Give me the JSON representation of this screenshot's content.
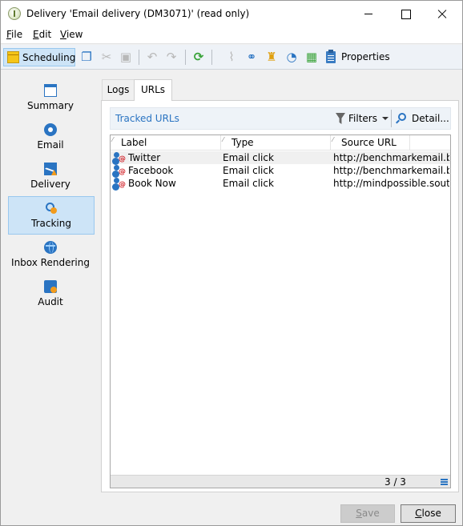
{
  "window": {
    "title": "Delivery 'Email delivery (DM3071)' (read only)",
    "icon": "delivery-app-icon",
    "controls": [
      "minimize-icon",
      "maximize-icon",
      "close-icon"
    ]
  },
  "menu": {
    "file": {
      "mnemonic": "F",
      "rest": "ile"
    },
    "edit": {
      "mnemonic": "E",
      "rest": "dit"
    },
    "view": {
      "mnemonic": "V",
      "rest": "iew"
    }
  },
  "toolbar": {
    "scheduling_label": "Scheduling",
    "properties_label": "Properties",
    "icons": [
      "calendar-icon",
      "copy-icon",
      "cut-icon",
      "paste-icon",
      "undo-icon",
      "redo-icon",
      "refresh-icon",
      "attachment-icon",
      "link-icon",
      "gift-icon",
      "analyze-icon",
      "calculator-icon",
      "clipboard-icon"
    ],
    "accent_color": "#2a74c2",
    "green": "#3aa33a"
  },
  "nav": {
    "items": [
      {
        "label": "Summary",
        "icon": "summary-icon"
      },
      {
        "label": "Email",
        "icon": "email-icon"
      },
      {
        "label": "Delivery",
        "icon": "delivery-icon"
      },
      {
        "label": "Tracking",
        "icon": "tracking-icon",
        "selected": true
      },
      {
        "label": "Inbox Rendering",
        "icon": "globe-icon"
      },
      {
        "label": "Audit",
        "icon": "audit-icon"
      }
    ],
    "selected_color": "#cde4f7"
  },
  "tabs": [
    {
      "label": "Logs",
      "active": false
    },
    {
      "label": "URLs",
      "active": true
    }
  ],
  "urls": {
    "title": "Tracked URLs",
    "filters_label": "Filters",
    "detail_label": "Detail...",
    "columns": [
      "Label",
      "Type",
      "Source URL"
    ],
    "rows": [
      {
        "label": "Twitter",
        "type": "Email click",
        "source": "http://benchmarkemail.b..."
      },
      {
        "label": "Facebook",
        "type": "Email click",
        "source": "http://benchmarkemail.b..."
      },
      {
        "label": "Book Now",
        "type": "Email click",
        "source": "http://mindpossible.sout..."
      }
    ],
    "count": "3 / 3"
  },
  "footer": {
    "save": {
      "mnemonic": "S",
      "rest": "ave",
      "enabled": false
    },
    "close": {
      "mnemonic": "C",
      "rest": "lose",
      "enabled": true
    }
  }
}
